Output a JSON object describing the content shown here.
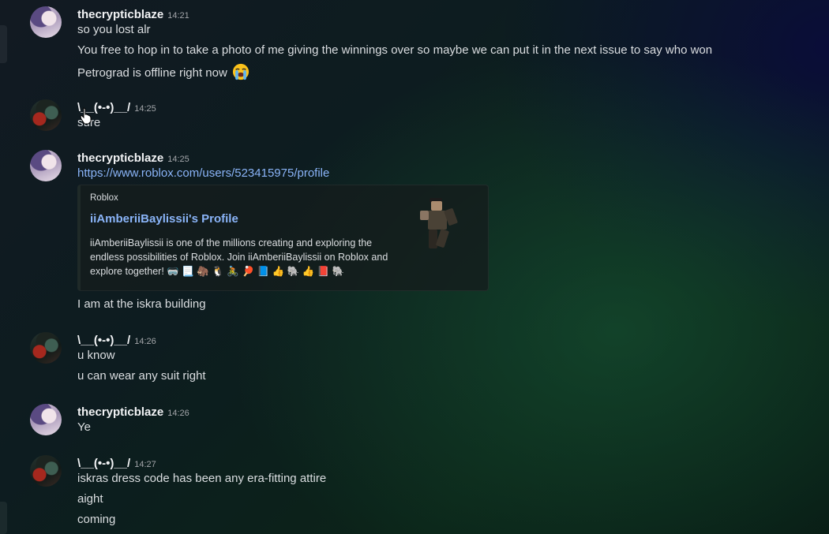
{
  "messages": [
    {
      "author": "thecrypticblaze",
      "time": "14:21",
      "avatar_icon": "anime-avatar-icon",
      "lines": [
        "so you lost alr",
        "You free to hop in to take a photo of me giving the winnings over so maybe we can put it in the next issue to say who won",
        "Petrograd is offline right now"
      ],
      "reaction_emoji": "loudly-crying-face-icon"
    },
    {
      "author": "\\__(•-•)__/",
      "time": "14:25",
      "avatar_icon": "dark-avatar-icon",
      "lines": [
        "sure"
      ]
    },
    {
      "author": "thecrypticblaze",
      "time": "14:25",
      "avatar_icon": "anime-avatar-icon",
      "link": "https://www.roblox.com/users/523415975/profile",
      "embed": {
        "provider": "Roblox",
        "title": "iiAmberiiBaylissii's Profile",
        "description": "iiAmberiiBaylissii is one of the millions creating and exploring the endless possibilities of Roblox. Join iiAmberiiBaylissii on Roblox and explore together! 🥽 📃 🦣 🐧 🚴 🏓 📘 👍 🐘 👍 📕 🐘",
        "thumbnail_icon": "roblox-avatar-figure-icon"
      },
      "lines": [
        "I am at the iskra building"
      ]
    },
    {
      "author": "\\__(•-•)__/",
      "time": "14:26",
      "avatar_icon": "dark-avatar-icon",
      "lines": [
        "u know",
        "u can wear any suit right"
      ]
    },
    {
      "author": "thecrypticblaze",
      "time": "14:26",
      "avatar_icon": "anime-avatar-icon",
      "lines": [
        "Ye"
      ]
    },
    {
      "author": "\\__(•-•)__/",
      "time": "14:27",
      "avatar_icon": "dark-avatar-icon",
      "lines": [
        "iskras dress code has been any era-fitting attire",
        "aight",
        "coming"
      ]
    }
  ],
  "colors": {
    "link": "#8ab4f8",
    "author": "#f2f3f5",
    "text": "#dbdee1",
    "timestamp": "#a3a6aa"
  }
}
